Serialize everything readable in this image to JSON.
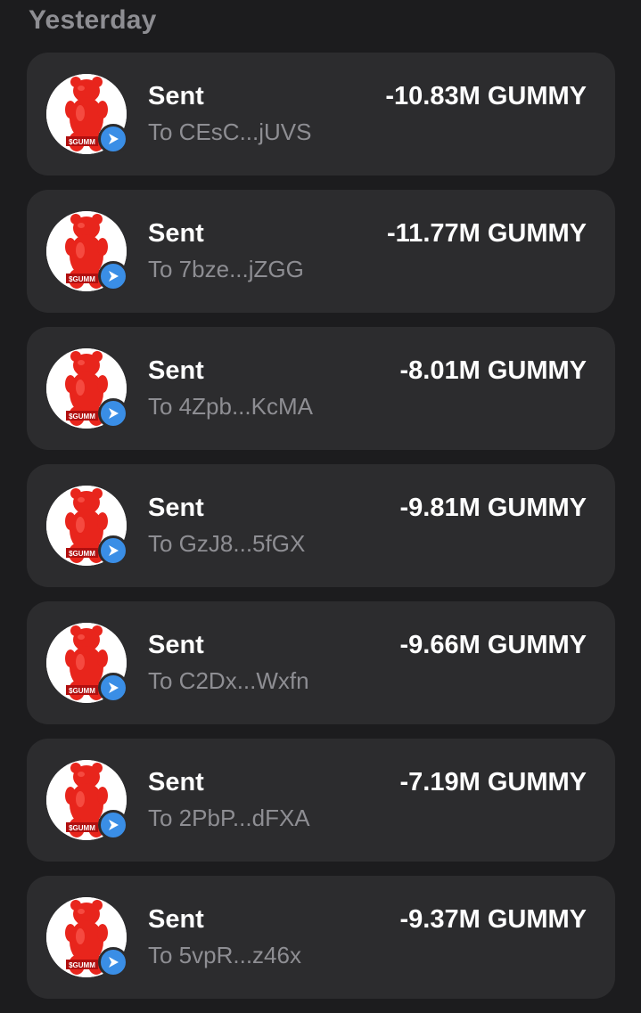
{
  "section": {
    "title": "Yesterday"
  },
  "colors": {
    "background": "#1c1c1e",
    "card": "#2c2c2e",
    "muted": "#8e8e93",
    "badge": "#3a8ee6",
    "token_red": "#e8251c"
  },
  "token": {
    "icon": "gummy-bear-token-icon",
    "logo_text": "$GUMM"
  },
  "transactions": [
    {
      "type": "Sent",
      "to": "To CEsC...jUVS",
      "amount": "-10.83M GUMMY"
    },
    {
      "type": "Sent",
      "to": "To 7bze...jZGG",
      "amount": "-11.77M GUMMY"
    },
    {
      "type": "Sent",
      "to": "To 4Zpb...KcMA",
      "amount": "-8.01M GUMMY"
    },
    {
      "type": "Sent",
      "to": "To GzJ8...5fGX",
      "amount": "-9.81M GUMMY"
    },
    {
      "type": "Sent",
      "to": "To C2Dx...Wxfn",
      "amount": "-9.66M GUMMY"
    },
    {
      "type": "Sent",
      "to": "To 2PbP...dFXA",
      "amount": "-7.19M GUMMY"
    },
    {
      "type": "Sent",
      "to": "To 5vpR...z46x",
      "amount": "-9.37M GUMMY"
    }
  ]
}
